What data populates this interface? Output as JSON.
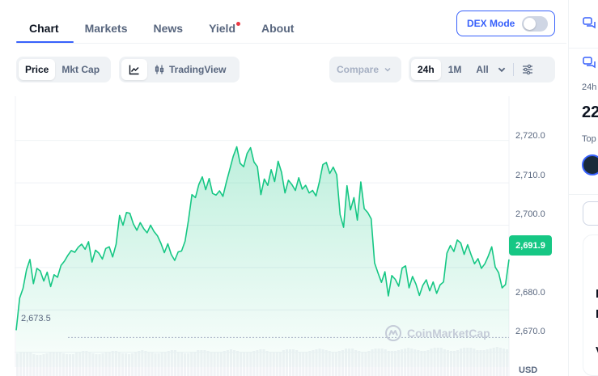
{
  "nav": {
    "tabs": [
      {
        "label": "Chart",
        "active": true
      },
      {
        "label": "Markets",
        "active": false
      },
      {
        "label": "News",
        "active": false
      },
      {
        "label": "Yield",
        "active": false,
        "notification": true
      },
      {
        "label": "About",
        "active": false
      }
    ],
    "dex_mode_label": "DEX Mode",
    "dex_mode_on": false
  },
  "toolbar": {
    "metric": [
      "Price",
      "Mkt Cap"
    ],
    "metric_selected": "Price",
    "view": [
      "line-chart-icon",
      "candlestick-icon"
    ],
    "tradingview_label": "TradingView",
    "compare_label": "Compare",
    "ranges": [
      "24h",
      "1M",
      "All"
    ],
    "range_selected": "24h"
  },
  "chart": {
    "current_price_label": "2,691.9",
    "min_price_label": "2,673.5",
    "watermark": "CoinMarketCap",
    "currency": "USD",
    "y_ticks": [
      "2,720.0",
      "2,710.0",
      "2,700.0",
      "2,680.0",
      "2,670.0"
    ]
  },
  "chart_data": {
    "type": "area",
    "ylim": [
      2666.5,
      2727
    ],
    "current": 2691.9,
    "min": 2673.5,
    "series": [
      {
        "values": [
          2675.2,
          2682.8,
          2685.1,
          2689.5,
          2691.9,
          2686.2,
          2689.8,
          2689.2,
          2686.8,
          2688.9,
          2685.5,
          2688.3,
          2687.7,
          2690.5,
          2691.5,
          2692.9,
          2694.0,
          2693.6,
          2694.8,
          2695.5,
          2694.3,
          2696.1,
          2691.3,
          2694.1,
          2693.4,
          2692.0,
          2694.5,
          2694.9,
          2692.5,
          2695.5,
          2702.3,
          2700.0,
          2703.0,
          2702.8,
          2700.3,
          2698.8,
          2700.6,
          2699.2,
          2698.2,
          2700.0,
          2698.5,
          2697.5,
          2695.7,
          2693.5,
          2695.6,
          2693.1,
          2691.7,
          2693.7,
          2693.9,
          2696.2,
          2701.2,
          2707.2,
          2706.5,
          2709.6,
          2711.4,
          2708.4,
          2711.0,
          2707.5,
          2707.1,
          2708.1,
          2706.8,
          2710.2,
          2713.2,
          2716.3,
          2718.5,
          2714.6,
          2713.8,
          2716.9,
          2718.3,
          2714.9,
          2713.8,
          2707.2,
          2710.9,
          2709.4,
          2713.1,
          2710.3,
          2715.1,
          2712.5,
          2707.6,
          2710.6,
          2709.6,
          2708.2,
          2711.2,
          2708.5,
          2709.4,
          2707.6,
          2708.2,
          2706.9,
          2710.3,
          2714.3,
          2714.8,
          2712.2,
          2713.7,
          2711.9,
          2702.5,
          2699.5,
          2709.3,
          2703.6,
          2706.5,
          2701.2,
          2710.2,
          2703.9,
          2703.0,
          2701.5,
          2691.1,
          2688.7,
          2686.5,
          2689.0,
          2683.3,
          2688.1,
          2687.2,
          2685.6,
          2689.9,
          2690.4,
          2685.2,
          2687.9,
          2686.1,
          2683.4,
          2685.8,
          2687.1,
          2684.5,
          2686.6,
          2683.9,
          2685.9,
          2686.6,
          2693.4,
          2695.2,
          2693.8,
          2696.5,
          2695.8,
          2693.1,
          2695.4,
          2693.0,
          2690.9,
          2692.1,
          2689.8,
          2690.9,
          2692.7,
          2694.9,
          2690.1,
          2688.8,
          2685.2,
          2686.0,
          2691.9
        ]
      }
    ]
  },
  "sidebar": {
    "label_24h": "24h",
    "big_value": "22",
    "label_top": "Top",
    "chars": [
      "I",
      "I",
      "V"
    ]
  },
  "colors": {
    "accent": "#3861fb",
    "up": "#16c784",
    "notification": "#ea3943"
  }
}
